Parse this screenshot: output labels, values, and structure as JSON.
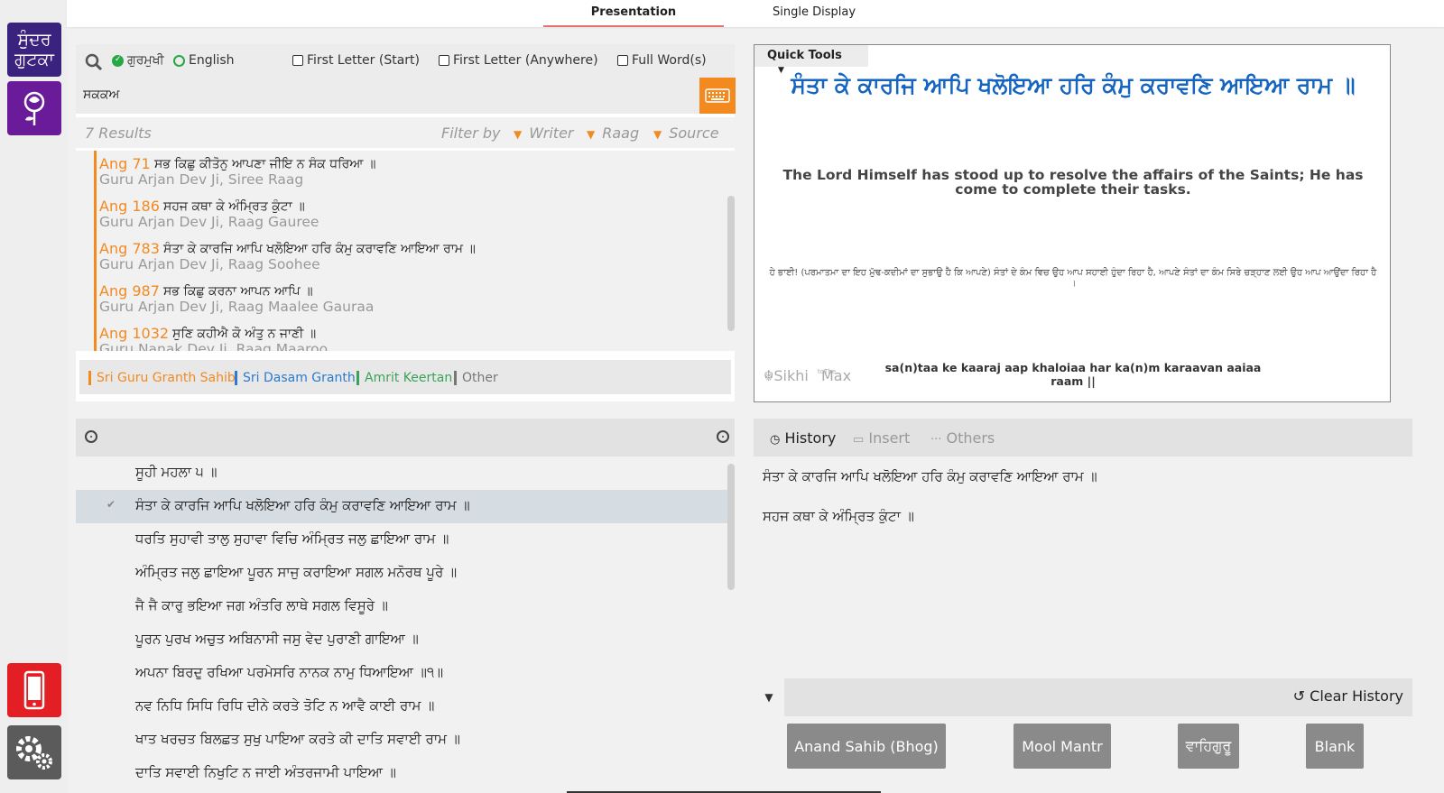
{
  "nav": {
    "sundar_label": "ਸੁੰਦਰ ਗੁਟਕਾ",
    "icons": [
      "rose-icon",
      "mobile-icon",
      "gear-icon"
    ],
    "colors": {
      "sundar": "#3a237e",
      "rose": "#6a1b9a",
      "mobile": "#e31e24",
      "settings": "#5b5b5b"
    }
  },
  "top_tabs": {
    "presentation": "Presentation",
    "single": "Single Display"
  },
  "search": {
    "gurmukhi_label": "ਗੁਰਮੁਖੀ",
    "english_label": "English",
    "first_letter_start": "First Letter (Start)",
    "first_letter_anywhere": "First Letter (Anywhere)",
    "full_words": "Full Word(s)",
    "query": "ਸਕਕਅ"
  },
  "results_bar": {
    "count": "7 Results",
    "filter_by": "Filter by",
    "writer": "Writer",
    "raag": "Raag",
    "source": "Source"
  },
  "results": [
    {
      "ang": "Ang 71",
      "gurbani": "ਸਭ ਕਿਛੁ ਕੀਤੋਨੁ ਆਪਣਾ ਜੀਇ ਨ ਸੰਕ ਧਰਿਆ ॥",
      "author": "Guru Arjan Dev Ji, Siree Raag"
    },
    {
      "ang": "Ang 186",
      "gurbani": "ਸਹਜ ਕਥਾ ਕੇ ਅੰਮ੍ਰਿਤ ਕੁੰਟਾ ॥",
      "author": "Guru Arjan Dev Ji, Raag Gauree"
    },
    {
      "ang": "Ang 783",
      "gurbani": "ਸੰਤਾ ਕੇ ਕਾਰਜਿ ਆਪਿ ਖਲੋਇਆ ਹਰਿ ਕੰਮੁ ਕਰਾਵਣਿ ਆਇਆ ਰਾਮ ॥",
      "author": "Guru Arjan Dev Ji, Raag Soohee"
    },
    {
      "ang": "Ang 987",
      "gurbani": "ਸਭ ਕਿਛੁ ਕਰਨਾ ਆਪਨ ਆਪਿ ॥",
      "author": "Guru Arjan Dev Ji, Raag Maalee Gauraa"
    },
    {
      "ang": "Ang 1032",
      "gurbani": "ਸੁਣਿ ਕਹੀਐ ਕੋ ਅੰਤੁ ਨ ਜਾਣੀ ॥",
      "author": "Guru Nanak Dev Ji, Raag Maaroo"
    }
  ],
  "sources": [
    {
      "label": "Sri Guru Granth Sahib",
      "color": "#f28a20"
    },
    {
      "label": "Sri Dasam Granth",
      "color": "#2a7bd1"
    },
    {
      "label": "Amrit Keertan",
      "color": "#3aa35a"
    },
    {
      "label": "Other",
      "color": "#777777"
    }
  ],
  "preview": {
    "quick_tools": "Quick Tools",
    "gurbani": "ਸੰਤਾ ਕੇ ਕਾਰਜਿ ਆਪਿ ਖਲੋਇਆ ਹਰਿ ਕੰਮੁ ਕਰਾਵਣਿ ਆਇਆ ਰਾਮ ॥",
    "english": "The Lord Himself has stood up to resolve the affairs of the Saints; He has come to complete their tasks.",
    "punjabi": "ਹੇ ਭਾਈ! (ਪਰਮਾਤਮਾ ਦਾ ਇਹ ਮੁੱਢ-ਕਦੀਮਾਂ ਦਾ ਸੁਭਾਉ ਹੈ ਕਿ ਆਪਣੇ) ਸੰਤਾਂ ਦੇ ਕੰਮ ਵਿਚ ਉਹ ਆਪ ਸਹਾਈ ਹੁੰਦਾ ਰਿਹਾ ਹੈ, ਆਪਣੇ ਸੰਤਾਂ ਦਾ ਕੰਮ ਸਿਰੇ ਚੜ੍ਹਾਣ ਲਈ ਉਹ ਆਪ ਆਉਂਦਾ ਰਿਹਾ ਹੈ ।",
    "transliteration": "sa(n)taa ke kaaraj aap khaloiaa har ka(n)m karaavan aaiaa raam ||",
    "logo": "SikhiToTheMax",
    "gurbani_color": "#1565c0"
  },
  "shabad": {
    "lines": [
      "ਸੂਹੀ ਮਹਲਾ ੫ ॥",
      "ਸੰਤਾ ਕੇ ਕਾਰਜਿ ਆਪਿ ਖਲੋਇਆ ਹਰਿ ਕੰਮੁ ਕਰਾਵਣਿ ਆਇਆ ਰਾਮ ॥",
      "ਧਰਤਿ ਸੁਹਾਵੀ ਤਾਲੁ ਸੁਹਾਵਾ ਵਿਚਿ ਅੰਮ੍ਰਿਤ ਜਲੁ ਛਾਇਆ ਰਾਮ ॥",
      "ਅੰਮ੍ਰਿਤ ਜਲੁ ਛਾਇਆ ਪੂਰਨ ਸਾਜੁ ਕਰਾਇਆ ਸਗਲ ਮਨੋਰਥ ਪੂਰੇ ॥",
      "ਜੈ ਜੈ ਕਾਰੁ ਭਇਆ ਜਗ ਅੰਤਰਿ ਲਾਥੇ ਸਗਲ ਵਿਸੂਰੇ ॥",
      "ਪੂਰਨ ਪੁਰਖ ਅਚੁਤ ਅਬਿਨਾਸੀ ਜਸੁ ਵੇਦ ਪੁਰਾਣੀ ਗਾਇਆ ॥",
      "ਅਪਨਾ ਬਿਰਦੁ ਰਖਿਆ ਪਰਮੇਸਰਿ ਨਾਨਕ ਨਾਮੁ ਧਿਆਇਆ ॥੧॥",
      "ਨਵ ਨਿਧਿ ਸਿਧਿ ਰਿਧਿ ਦੀਨੇ ਕਰਤੇ ਤੋਟਿ ਨ ਆਵੈ ਕਾਈ ਰਾਮ ॥",
      "ਖਾਤ ਖਰਚਤ ਬਿਲਛਤ ਸੁਖੁ ਪਾਇਆ ਕਰਤੇ ਕੀ ਦਾਤਿ ਸਵਾਈ ਰਾਮ ॥",
      "ਦਾਤਿ ਸਵਾਈ ਨਿਖੁਟਿ ਨ ਜਾਈ ਅੰਤਰਜਾਮੀ ਪਾਇਆ ॥"
    ]
  },
  "history": {
    "tabs": {
      "history": "History",
      "insert": "Insert",
      "others": "Others"
    },
    "items": [
      "ਸੰਤਾ ਕੇ ਕਾਰਜਿ ਆਪਿ ਖਲੋਇਆ ਹਰਿ ਕੰਮੁ ਕਰਾਵਣਿ ਆਇਆ ਰਾਮ ॥",
      "ਸਹਜ ਕਥਾ ਕੇ ਅੰਮ੍ਰਿਤ ਕੁੰਟਾ ॥"
    ],
    "clear": "Clear History",
    "quick_buttons": [
      "Anand Sahib (Bhog)",
      "Mool Mantr",
      "ਵਾਹਿਗੁਰੂ",
      "Blank"
    ]
  }
}
